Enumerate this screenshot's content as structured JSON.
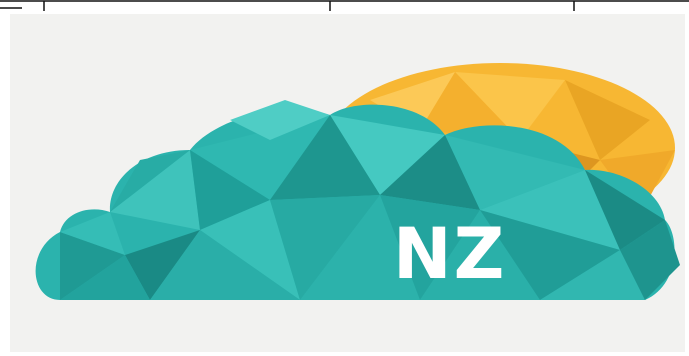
{
  "logo": {
    "text": "NZ",
    "icon": "sun-behind-cloud-icon",
    "colors": {
      "cloud": "#2bb3ad",
      "cloud_dark": "#1f8f8a",
      "cloud_light": "#4cc8c1",
      "sun": "#f7b733",
      "sun_dark": "#e09a1e",
      "text": "#ffffff",
      "background": "#f2f2f0"
    }
  }
}
